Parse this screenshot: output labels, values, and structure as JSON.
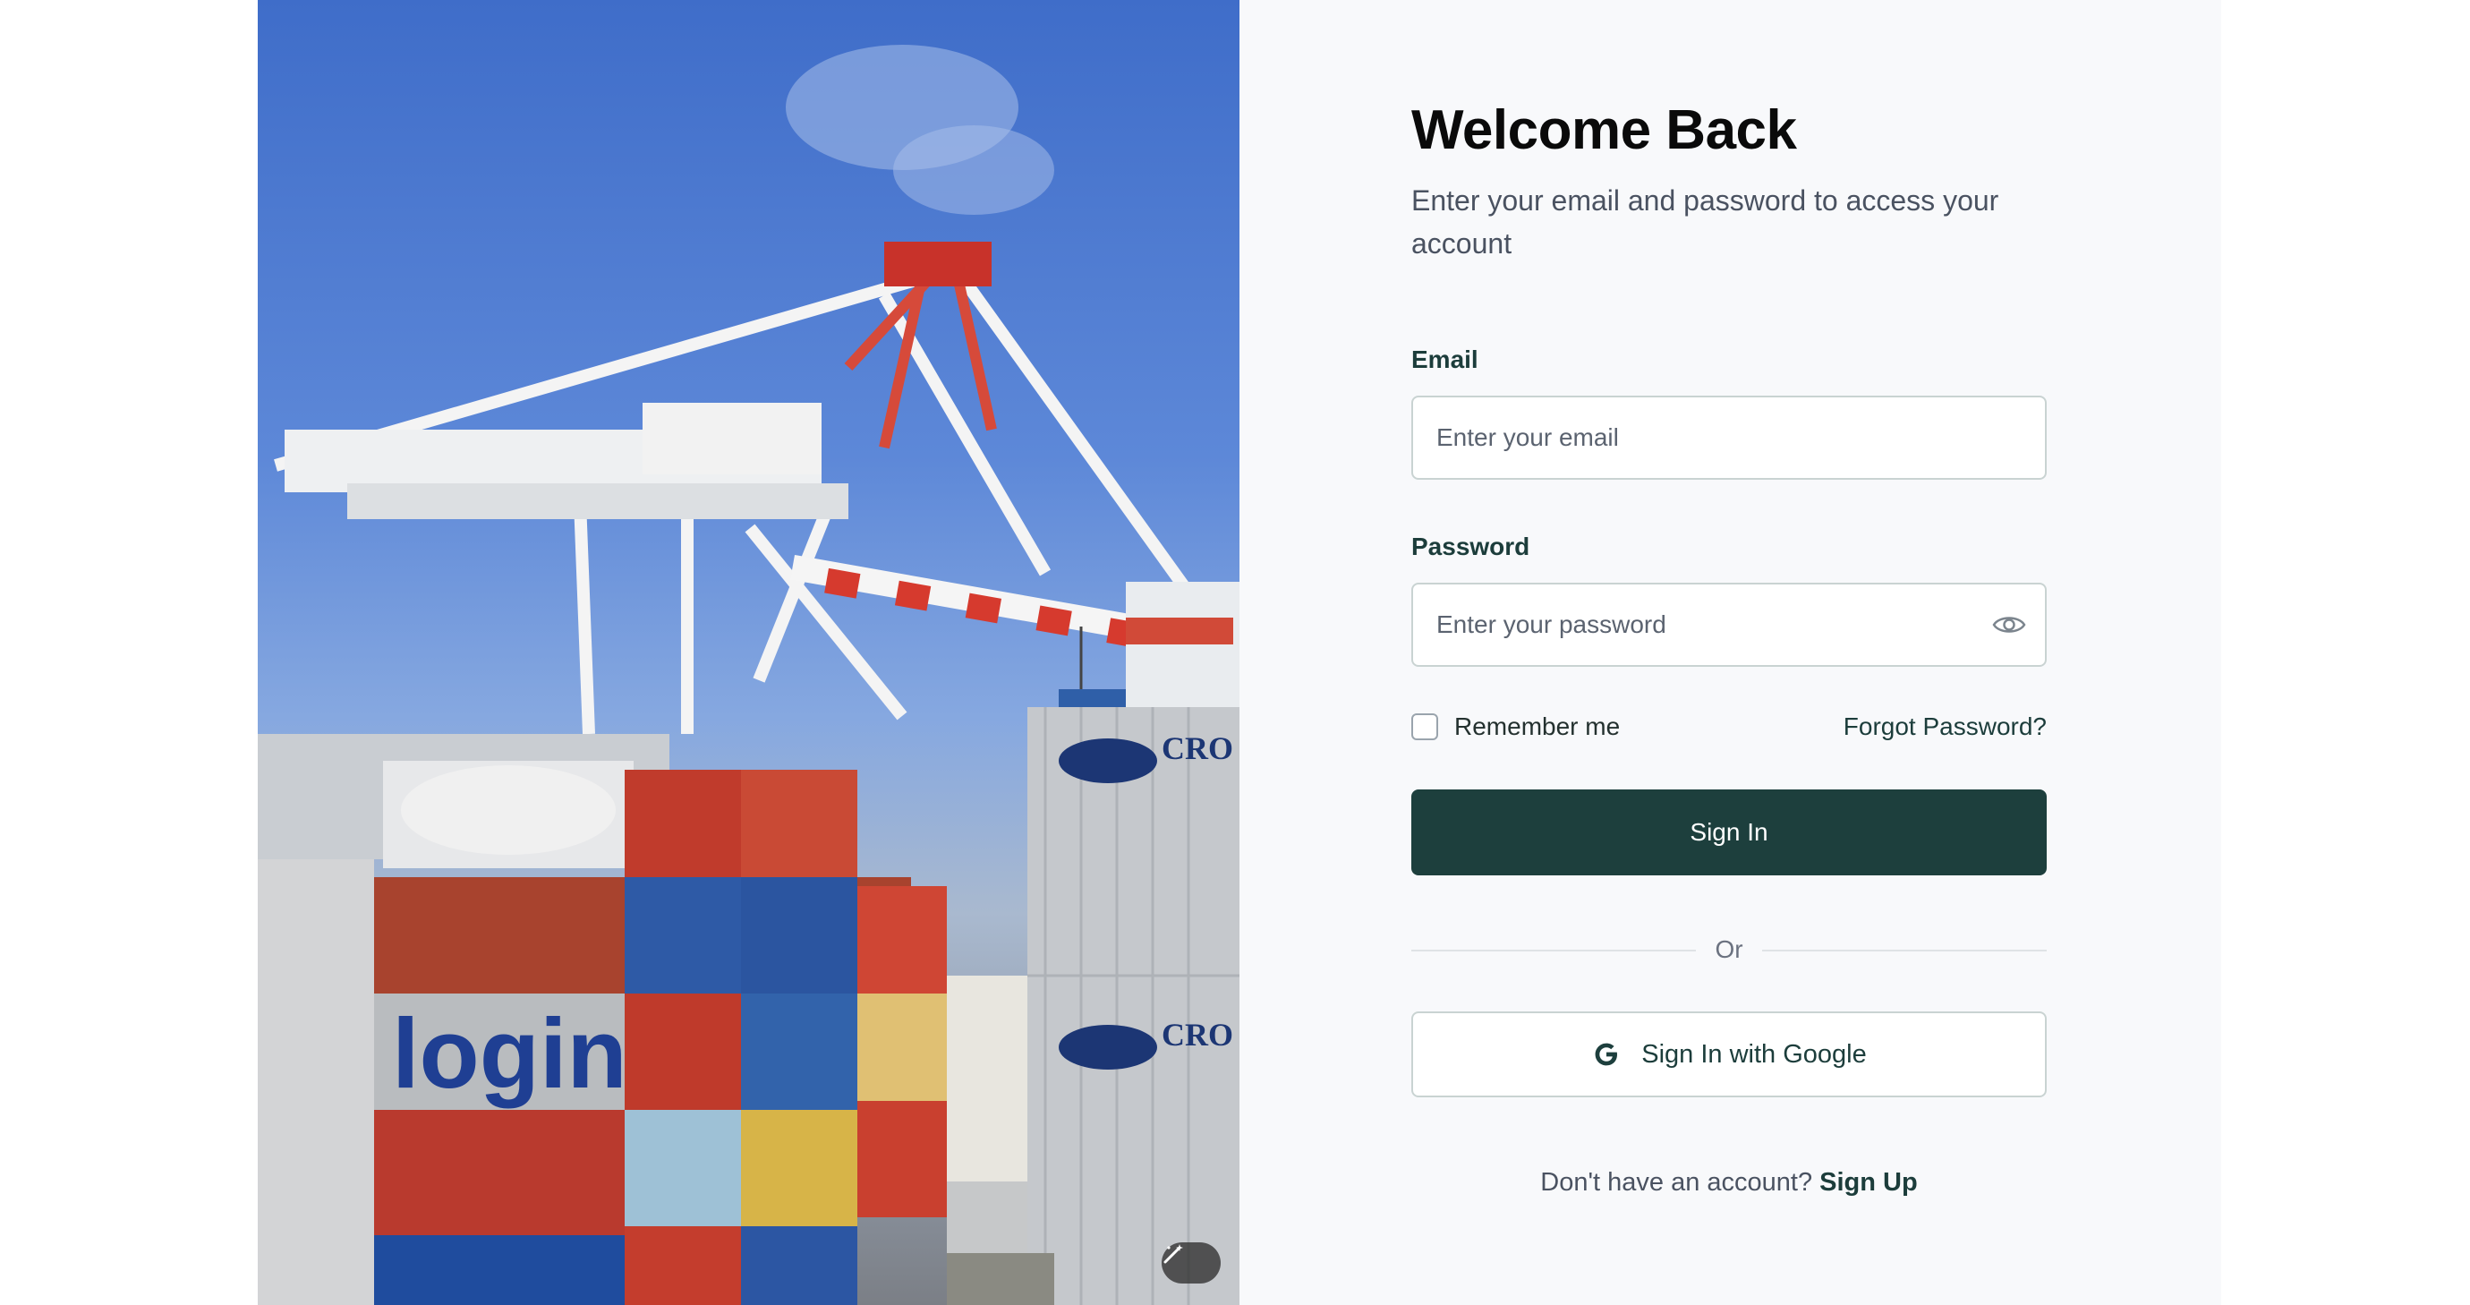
{
  "hero": {
    "alt": "Container port with gantry cranes and stacked shipping containers",
    "magic_icon": "magic-wand-icon"
  },
  "login": {
    "title": "Welcome Back",
    "subtitle": "Enter your email and password to access your account",
    "email_label": "Email",
    "email_placeholder": "Enter your email",
    "password_label": "Password",
    "password_placeholder": "Enter your password",
    "password_toggle_icon": "eye-icon",
    "remember_label": "Remember me",
    "forgot_label": "Forgot Password?",
    "submit_label": "Sign In",
    "divider_label": "Or",
    "google_label": "Sign In with Google",
    "google_icon": "google-icon",
    "signup_prompt": "Don't have an account?",
    "signup_link": "Sign Up"
  },
  "colors": {
    "primary": "#1d3f3d",
    "panel_background": "#f8f9fb",
    "input_border": "#c9d3d2"
  }
}
